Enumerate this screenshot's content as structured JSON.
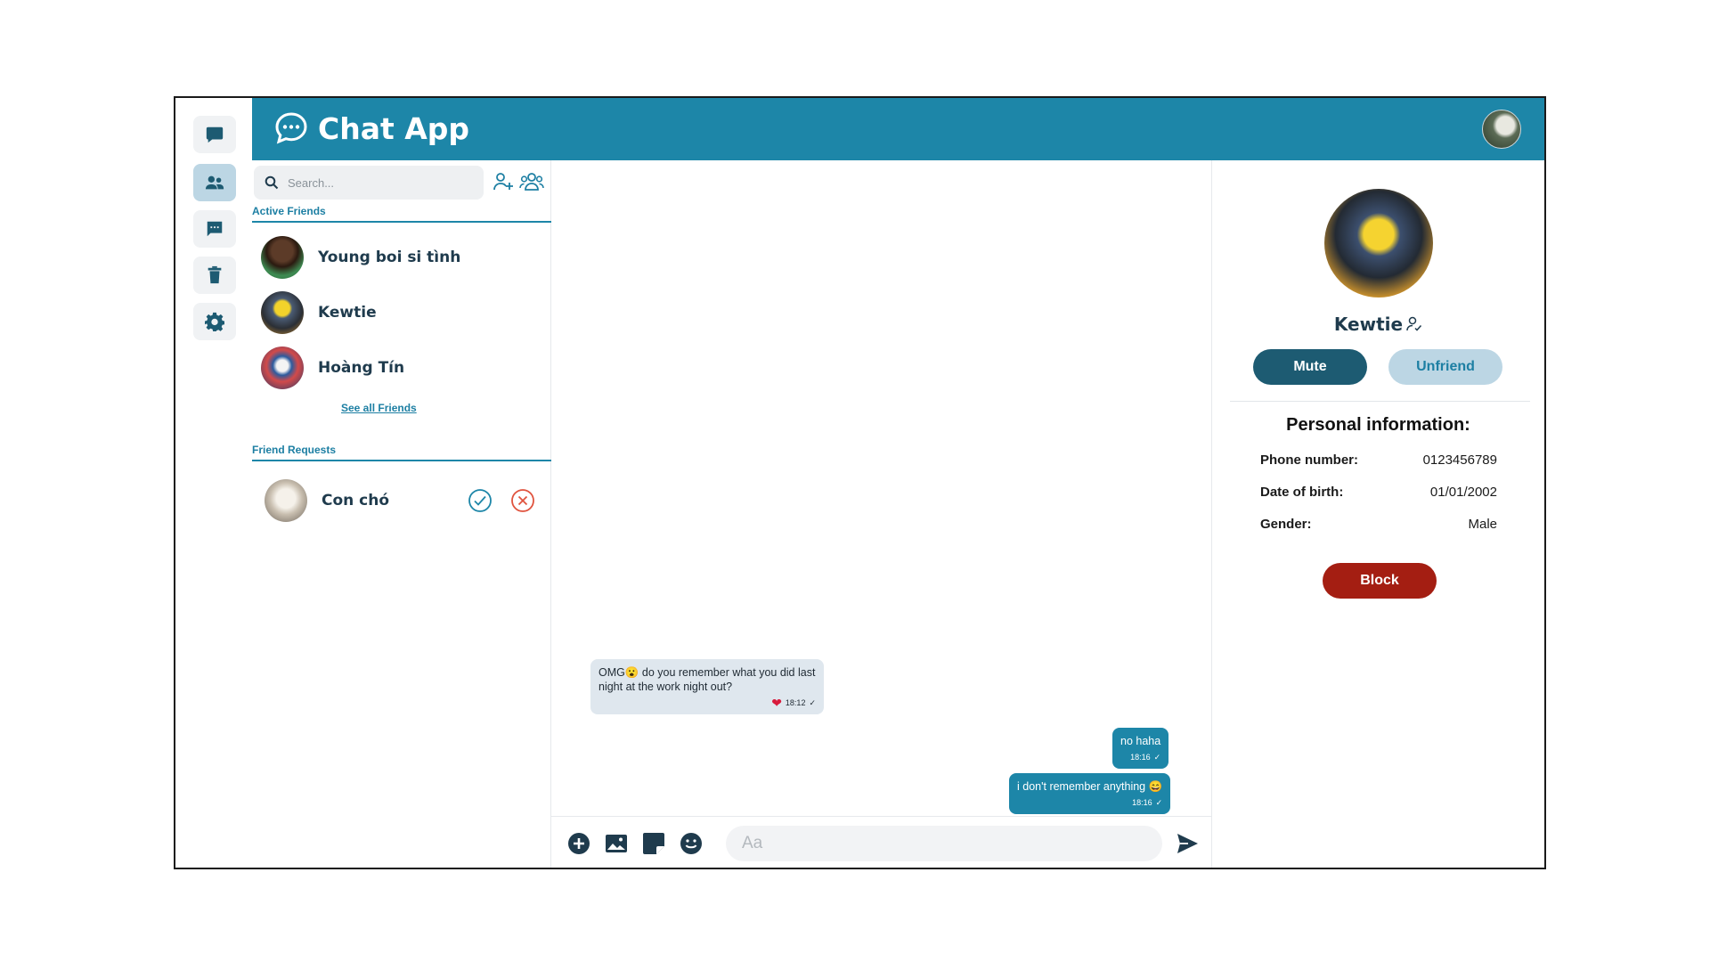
{
  "app": {
    "title": "Chat App"
  },
  "rail": {
    "items": [
      {
        "name": "messages",
        "icon": "chat-bubble-icon",
        "active": false
      },
      {
        "name": "friends",
        "icon": "users-icon",
        "active": true
      },
      {
        "name": "conversations",
        "icon": "message-square-icon",
        "active": false
      },
      {
        "name": "trash",
        "icon": "trash-icon",
        "active": false
      },
      {
        "name": "settings",
        "icon": "gear-icon",
        "active": false
      }
    ]
  },
  "friends_panel": {
    "search_placeholder": "Search...",
    "active_title": "Active Friends",
    "active_friends": [
      {
        "name": "Young boi si tình"
      },
      {
        "name": "Kewtie"
      },
      {
        "name": "Hoàng Tín"
      }
    ],
    "see_all_label": "See all Friends",
    "requests_title": "Friend Requests",
    "requests": [
      {
        "name": "Con chó"
      }
    ]
  },
  "chat": {
    "messages": [
      {
        "direction": "in",
        "text": "OMG😮 do you remember what you did last night at the work night out?",
        "time": "18:12",
        "reaction": "❤",
        "status": "✓"
      },
      {
        "direction": "out",
        "text": "no haha",
        "time": "18:16",
        "status": "✓"
      },
      {
        "direction": "out",
        "text": "i don't remember anything 😄",
        "time": "18:16",
        "status": "✓"
      }
    ],
    "composer_placeholder": "Aa"
  },
  "profile": {
    "name": "Kewtie",
    "mute_label": "Mute",
    "unfriend_label": "Unfriend",
    "info_title": "Personal information:",
    "phone_label": "Phone number:",
    "phone_value": "0123456789",
    "dob_label": "Date of birth:",
    "dob_value": "01/01/2002",
    "gender_label": "Gender:",
    "gender_value": "Male",
    "block_label": "Block"
  },
  "colors": {
    "brand": "#1d86a8",
    "dark_accent": "#1d5b72",
    "light_accent": "#bcd6e4",
    "danger": "#a41e12"
  }
}
